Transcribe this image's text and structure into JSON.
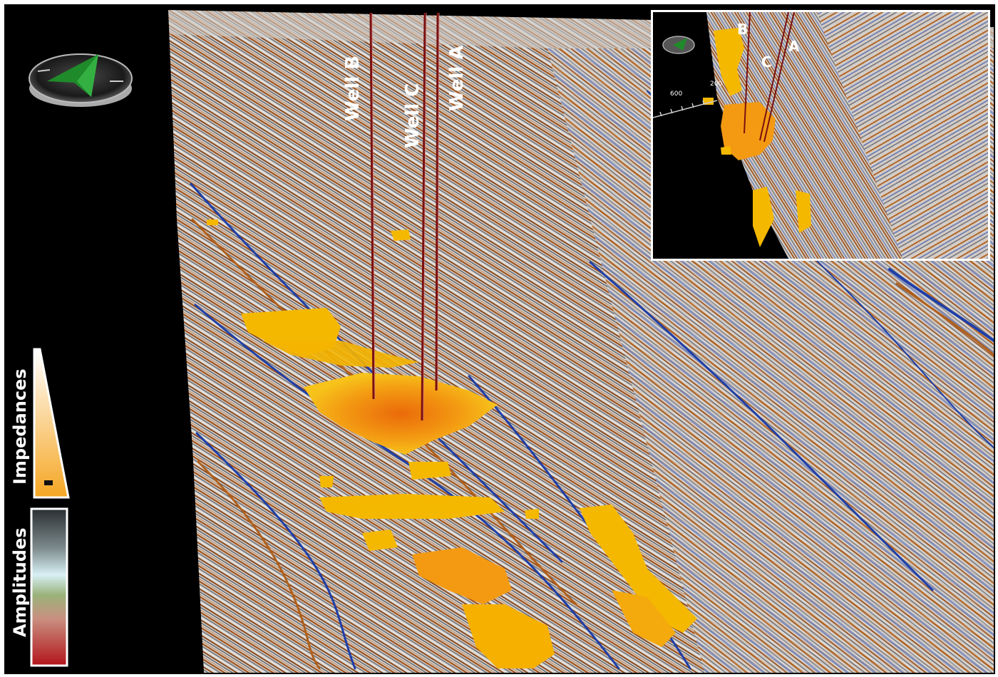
{
  "wells": {
    "well_b": "Well B",
    "well_c": "Well C",
    "well_a": "Well A"
  },
  "inset": {
    "label_b": "B",
    "label_c": "C",
    "label_a": "A",
    "scale_600": "600",
    "scale_200": "200"
  },
  "legend": {
    "impedances_label": "Impedances",
    "amplitudes_label": "Amplitudes"
  },
  "colors": {
    "background": "#000000",
    "seismic_orange": "#b5651d",
    "seismic_blue": "#1f3fa8",
    "seismic_grey": "#7a7f86",
    "impedance_yellow": "#f5b800",
    "impedance_orange": "#ea7a10",
    "well_line": "#7a1010",
    "compass_green": "#1f8a2a"
  },
  "icons": {
    "compass": "compass-icon",
    "inset_compass": "compass-icon"
  }
}
